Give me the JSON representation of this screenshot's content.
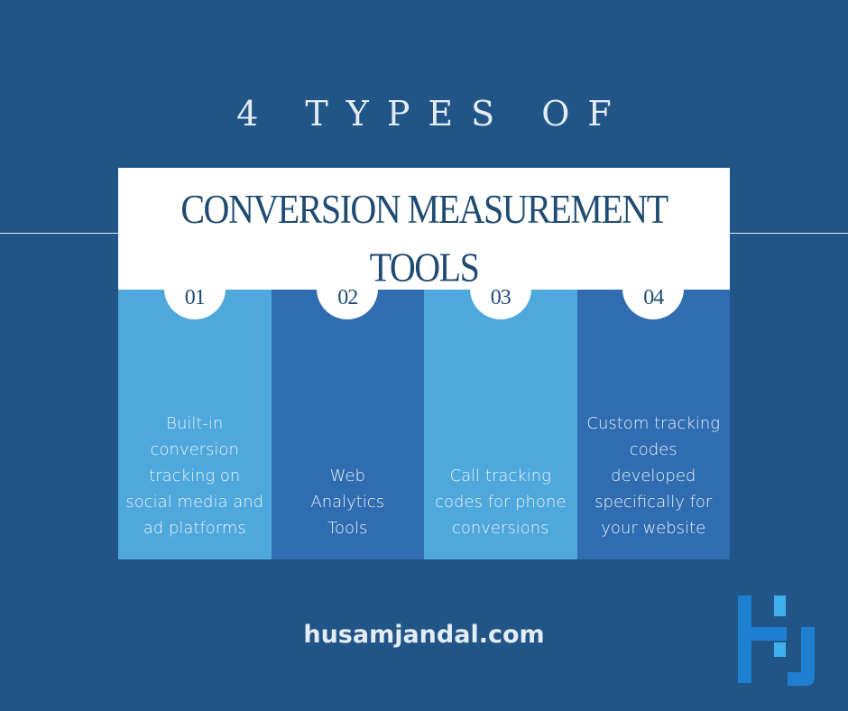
{
  "header": {
    "kicker": "4 TYPES OF",
    "title_line1": "CONVERSION MEASUREMENT",
    "title_line2": "TOOLS"
  },
  "columns": [
    {
      "number": "01",
      "text": "Built-in\nconversion\ntracking on\nsocial media and\nad platforms",
      "shade": "light"
    },
    {
      "number": "02",
      "text": "Web\nAnalytics\nTools",
      "shade": "dark"
    },
    {
      "number": "03",
      "text": "Call tracking\ncodes for phone\nconversions",
      "shade": "light"
    },
    {
      "number": "04",
      "text": "Custom tracking\ncodes\ndeveloped\nspecifically for\nyour website",
      "shade": "dark"
    }
  ],
  "footer": {
    "website": "husamjandal.com",
    "logo": "HJ-monogram-logo"
  },
  "colors": {
    "background": "#215587",
    "column_light": "#4ea8dc",
    "column_dark": "#2f6db0",
    "title_text": "#1f4b73",
    "logo_main": "#1e7fd0",
    "logo_accent": "#3fb0ec"
  }
}
